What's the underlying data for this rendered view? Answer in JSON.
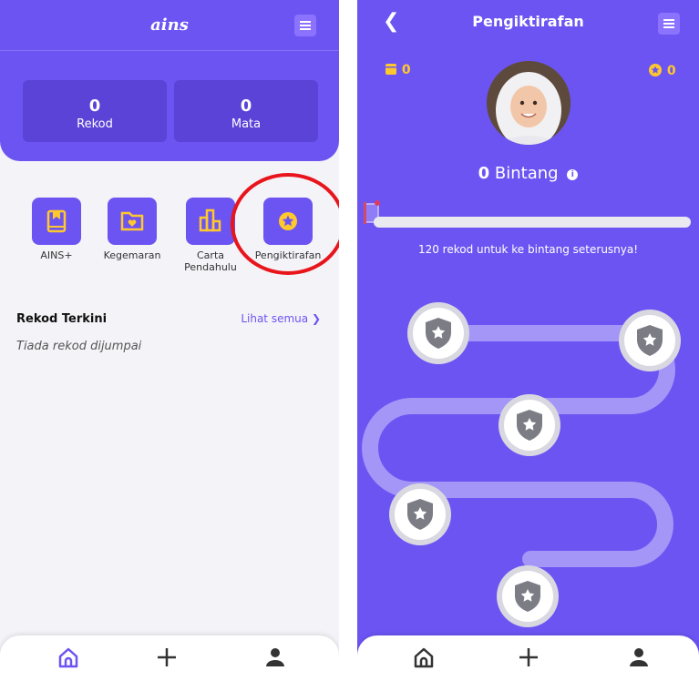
{
  "left": {
    "app_logo": "ains",
    "stats": [
      {
        "value": "0",
        "label": "Rekod"
      },
      {
        "value": "0",
        "label": "Mata"
      }
    ],
    "quick_actions": [
      {
        "label": "AINS+",
        "icon": "book-icon"
      },
      {
        "label": "Kegemaran",
        "icon": "heart-folder-icon"
      },
      {
        "label": "Carta Pendahulu",
        "icon": "leaderboard-icon"
      },
      {
        "label": "Pengiktirafan",
        "icon": "star-badge-icon"
      }
    ],
    "recent": {
      "title": "Rekod Terkini",
      "see_all": "Lihat semua",
      "empty_text": "Tiada rekod dijumpai"
    }
  },
  "right": {
    "title": "Pengiktirafan",
    "books_count": "0",
    "stars_count": "0",
    "star_total": "0",
    "star_label": "Bintang",
    "next_star_text": "120 rekod untuk ke bintang seterusnya!",
    "progress_fraction": 0,
    "milestones": 5
  },
  "bottom_nav": {
    "items": [
      "home-icon",
      "add-icon",
      "profile-icon"
    ]
  },
  "colors": {
    "primary": "#6c54f3",
    "accent": "#ffc82c",
    "highlight_circle": "#e8161c"
  }
}
